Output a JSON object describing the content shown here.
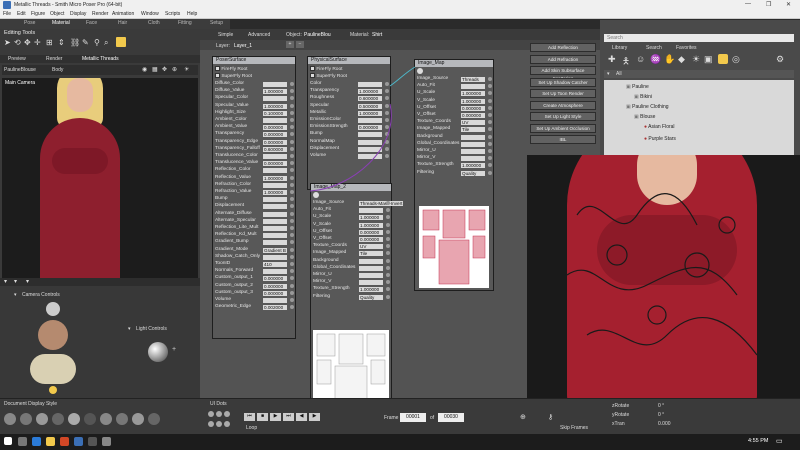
{
  "window": {
    "title": "Metallic Threads - Smith Micro Poser Pro (64-bit)"
  },
  "menu": [
    "File",
    "Edit",
    "Figure",
    "Object",
    "Display",
    "Render",
    "Animation",
    "Window",
    "Scripts",
    "Help"
  ],
  "rooms": [
    "Pose",
    "Material",
    "Face",
    "Hair",
    "Cloth",
    "Fitting",
    "Setup"
  ],
  "left": {
    "editing_tools": "Editing Tools",
    "tab_preview": "Preview",
    "tab_render": "Render",
    "doc_title": "Metallic Threads",
    "figure_select": "PaulineBlouse",
    "part_select": "Body",
    "camera": "Main Camera",
    "camera_controls": "Camera Controls",
    "light_controls": "Light Controls",
    "doc_display_style": "Document Display Style"
  },
  "material": {
    "tab_simple": "Simple",
    "tab_advanced": "Advanced",
    "object_label": "Object:",
    "object_value": "PaulineBlou",
    "material_label": "Material:",
    "material_value": "Shirt",
    "layer_label": "Layer:",
    "layer_value": "Layer_1"
  },
  "poser_surface": {
    "title": "PoserSurface",
    "root1": "FireFly Root",
    "root2": "SuperFly Root",
    "rows": [
      {
        "l": "Diffuse_Color",
        "v": ""
      },
      {
        "l": "Diffuse_Value",
        "v": "1.000000"
      },
      {
        "l": "Specular_Color",
        "v": ""
      },
      {
        "l": "Specular_Value",
        "v": "1.000000"
      },
      {
        "l": "Highlight_Size",
        "v": "0.100000"
      },
      {
        "l": "Ambient_Color",
        "v": ""
      },
      {
        "l": "Ambient_Value",
        "v": "0.000000"
      },
      {
        "l": "Transparency",
        "v": "0.000000"
      },
      {
        "l": "Transparency_Edge",
        "v": "0.000000"
      },
      {
        "l": "Transparency_Falloff",
        "v": "0.600000"
      },
      {
        "l": "Translucence_Color",
        "v": ""
      },
      {
        "l": "Translucence_Value",
        "v": "0.000000"
      },
      {
        "l": "Reflection_Color",
        "v": ""
      },
      {
        "l": "Reflection_Value",
        "v": "1.000000"
      },
      {
        "l": "Refraction_Color",
        "v": ""
      },
      {
        "l": "Refraction_Value",
        "v": "1.000000"
      },
      {
        "l": "Bump",
        "v": ""
      },
      {
        "l": "Displacement",
        "v": ""
      },
      {
        "l": "Alternate_Diffuse",
        "v": ""
      },
      {
        "l": "Alternate_Specular",
        "v": ""
      },
      {
        "l": "Reflection_Lite_Mult",
        "v": ""
      },
      {
        "l": "Reflection_Kd_Mult",
        "v": ""
      },
      {
        "l": "Gradient_Bump",
        "v": ""
      },
      {
        "l": "Gradient_Mode",
        "v": "Gradient B"
      },
      {
        "l": "Shadow_Catch_Only",
        "v": ""
      },
      {
        "l": "ToonID",
        "v": "410"
      },
      {
        "l": "Normals_Forward",
        "v": ""
      },
      {
        "l": "Custom_output_1",
        "v": "0.000000"
      },
      {
        "l": "Custom_output_2",
        "v": "0.000000"
      },
      {
        "l": "Custom_output_3",
        "v": "0.000000"
      },
      {
        "l": "Volume",
        "v": ""
      },
      {
        "l": "Geometric_Edge",
        "v": "0.002000"
      }
    ]
  },
  "physical_surface": {
    "title": "PhysicalSurface",
    "root1": "FireFly Root",
    "root2": "SuperFly Root",
    "rows": [
      {
        "l": "Color",
        "v": ""
      },
      {
        "l": "Transparency",
        "v": "1.000000"
      },
      {
        "l": "Roughness",
        "v": "0.600000"
      },
      {
        "l": "Specular",
        "v": "0.500000"
      },
      {
        "l": "Metallic",
        "v": "1.000000"
      },
      {
        "l": "EmissionColor",
        "v": ""
      },
      {
        "l": "EmissionStrength",
        "v": "0.000000"
      },
      {
        "l": "Bump",
        "v": ""
      },
      {
        "l": "NormalMap",
        "v": ""
      },
      {
        "l": "Displacement",
        "v": ""
      },
      {
        "l": "Volume",
        "v": ""
      }
    ]
  },
  "image_map": {
    "title": "Image_Map",
    "rows": [
      {
        "l": "Image_Source",
        "v": "Threads"
      },
      {
        "l": "Auto_Fit",
        "v": ""
      },
      {
        "l": "U_Scale",
        "v": "1.000000"
      },
      {
        "l": "V_Scale",
        "v": "1.000000"
      },
      {
        "l": "U_Offset",
        "v": "0.000000"
      },
      {
        "l": "V_Offset",
        "v": "0.000000"
      },
      {
        "l": "Texture_Coords",
        "v": "UV"
      },
      {
        "l": "Image_Mapped",
        "v": "Tile"
      },
      {
        "l": "Background",
        "v": ""
      },
      {
        "l": "Global_Coordinates",
        "v": ""
      },
      {
        "l": "Mirror_U",
        "v": ""
      },
      {
        "l": "Mirror_V",
        "v": ""
      },
      {
        "l": "Texture_Strength",
        "v": "1.000000"
      },
      {
        "l": "Filtering",
        "v": "Quality"
      }
    ]
  },
  "image_map_2": {
    "title": "Image_Map_2",
    "rows": [
      {
        "l": "Image_Source",
        "v": "Threads-Mask-Invert"
      },
      {
        "l": "Auto_Fit",
        "v": ""
      },
      {
        "l": "U_Scale",
        "v": "1.000000"
      },
      {
        "l": "V_Scale",
        "v": "1.000000"
      },
      {
        "l": "U_Offset",
        "v": "0.000000"
      },
      {
        "l": "V_Offset",
        "v": "0.000000"
      },
      {
        "l": "Texture_Coords",
        "v": "UV"
      },
      {
        "l": "Image_Mapped",
        "v": "Tile"
      },
      {
        "l": "Background",
        "v": ""
      },
      {
        "l": "Global_Coordinates",
        "v": ""
      },
      {
        "l": "Mirror_U",
        "v": ""
      },
      {
        "l": "Mirror_V",
        "v": ""
      },
      {
        "l": "Texture_Strength",
        "v": "1.000000"
      },
      {
        "l": "Filtering",
        "v": "Quality"
      }
    ]
  },
  "wacros": [
    "Add Reflection",
    "Add Refraction",
    "Add Skin Subsurface Scattering",
    "Set Up Shadow Catcher",
    "Set Up Toon Render",
    "Create Atmosphere",
    "Set Up Light Style",
    "Set Up Ambient Occlusion",
    "IBL"
  ],
  "library": {
    "search_placeholder": "Search",
    "tabs": [
      "Library",
      "Search",
      "Favorites"
    ],
    "filter": "All",
    "tree": [
      "Pauline",
      "Bikini",
      "Pauline Clothing",
      "Blouse",
      "Asian Floral",
      "Purple Stars"
    ]
  },
  "timeline": {
    "frame_label": "Frame",
    "frame": "00001",
    "of": "of",
    "total": "00030",
    "loop": "Loop",
    "skip_frames": "Skip Frames",
    "ui_dots": "UI Dots"
  },
  "params": [
    {
      "l": "zRotate",
      "v": "0 °"
    },
    {
      "l": "yRotate",
      "v": "0 °"
    },
    {
      "l": "xTran",
      "v": "0.000"
    }
  ],
  "taskbar": {
    "time": "4:55 PM"
  },
  "colors": {
    "accent": "#f2c94c",
    "blouse": "#a5202f",
    "node_title": "#b6b8bc"
  }
}
